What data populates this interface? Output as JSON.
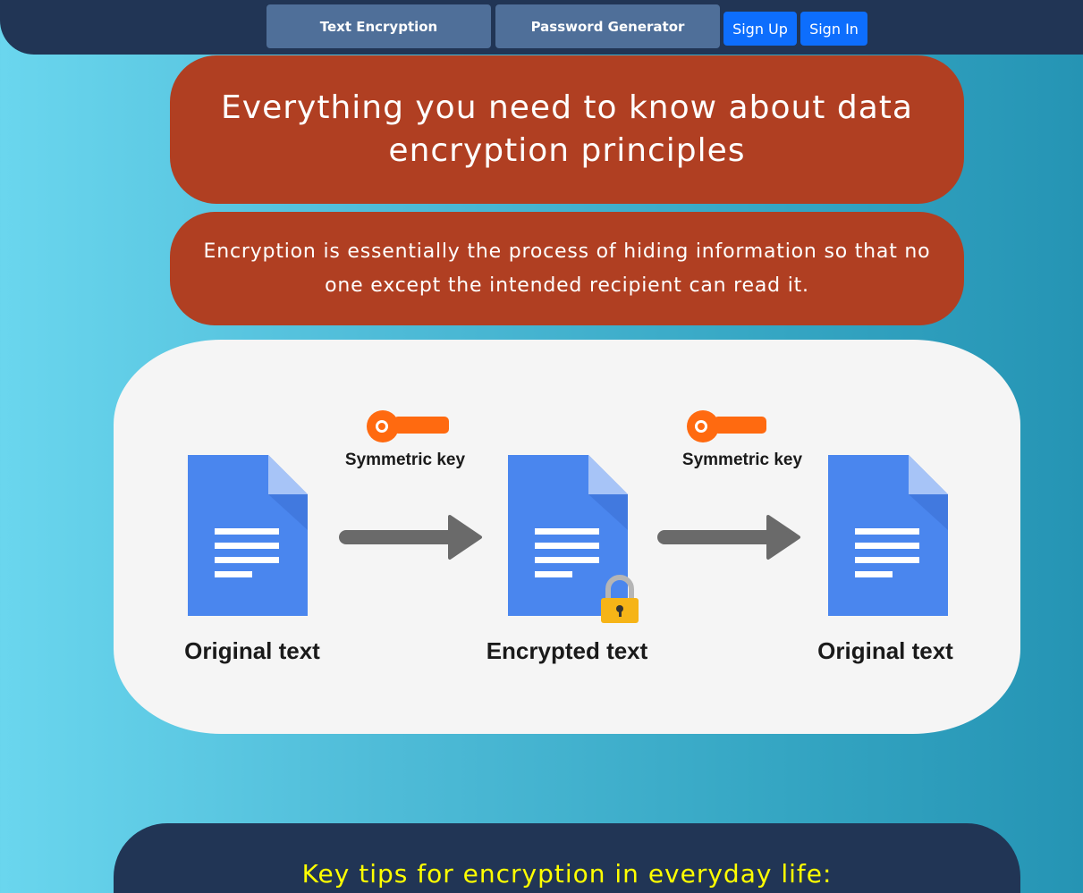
{
  "nav": {
    "text_encryption": "Text Encryption",
    "password_generator": "Password Generator",
    "sign_up": "Sign Up",
    "sign_in": "Sign In"
  },
  "hero": {
    "title": "Everything you need to know about data encryption principles",
    "intro": "Encryption is essentially the process of hiding information so that no one except the intended recipient can read it."
  },
  "diagram": {
    "doc_left_label": "Original text",
    "doc_middle_label": "Encrypted text",
    "doc_right_label": "Original text",
    "key_left_label": "Symmetric key",
    "key_right_label": "Symmetric key",
    "icons": [
      "document-icon",
      "key-icon",
      "arrow-right-icon",
      "lock-icon"
    ]
  },
  "tips": {
    "title": "Key tips for encryption in everyday life:"
  },
  "colors": {
    "topbar": "#213555",
    "nav_button": "#4f6f99",
    "auth_button": "#0d6efd",
    "card": "#b03f22",
    "document": "#4a86ee",
    "key": "#ff6a10",
    "lock": "#f6b417",
    "tips_title": "#ffff00"
  }
}
